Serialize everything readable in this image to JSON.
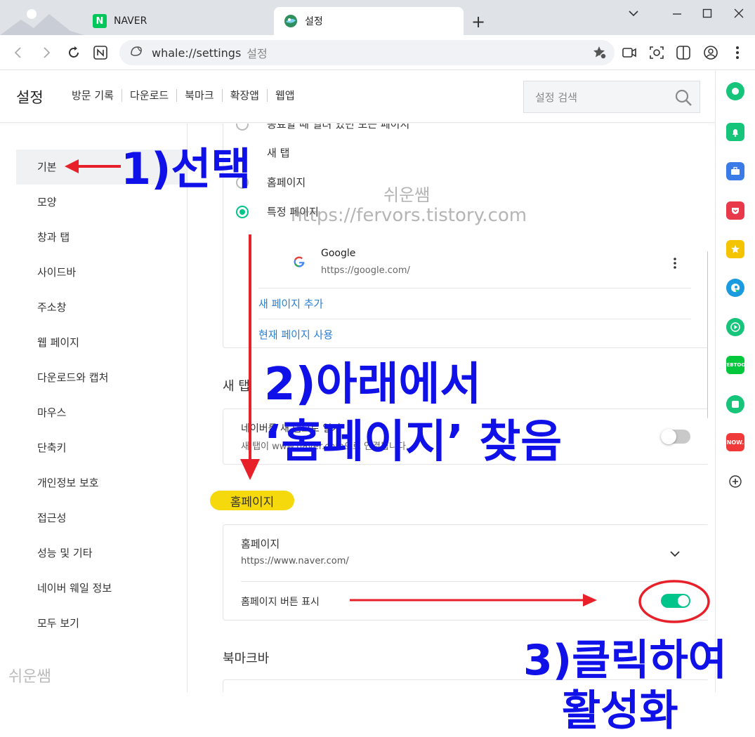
{
  "browser": {
    "tabs": [
      {
        "icon": "naver-n-icon",
        "favicon_text": "N",
        "title": "NAVER",
        "active": false
      },
      {
        "icon": "whale-icon",
        "title": "설정",
        "active": true
      }
    ],
    "new_tab_glyph": "+",
    "address": {
      "url": "whale://settings",
      "hint": "설정"
    }
  },
  "settings": {
    "title": "설정",
    "top_nav": [
      "방문 기록",
      "다운로드",
      "북마크",
      "확장앱",
      "웹앱"
    ],
    "search_placeholder": "설정 검색",
    "sidebar": [
      {
        "label": "기본",
        "active": true
      },
      {
        "label": "모양"
      },
      {
        "label": "창과 탭"
      },
      {
        "label": "사이드바"
      },
      {
        "label": "주소창"
      },
      {
        "label": "웹 페이지"
      },
      {
        "label": "다운로드와 캡처"
      },
      {
        "label": "마우스"
      },
      {
        "label": "단축키"
      },
      {
        "label": "개인정보 보호"
      },
      {
        "label": "접근성"
      },
      {
        "label": "성능 및 기타"
      },
      {
        "label": "네이버 웨일 정보"
      },
      {
        "label": "모두 보기"
      }
    ],
    "sidebar_watermark": "쉬운쌤",
    "startup": {
      "options": [
        "종료할 때 열려 있던 모든 페이지",
        "새 탭",
        "홈페이지",
        "특정 페이지"
      ],
      "selected": "특정 페이지",
      "page": {
        "name": "Google",
        "url": "https://google.com/"
      },
      "add_link": "새 페이지 추가",
      "use_current_link": "현재 페이지 사용"
    },
    "new_tab_section": {
      "title": "새 탭",
      "row_title": "네이버를 새 탭으로 열기",
      "row_desc": "새 탭이 www.naver.com으로 연결됩니다.",
      "toggle_on": false
    },
    "homepage_section": {
      "title": "홈페이지",
      "row_title": "홈페이지",
      "row_value": "https://www.naver.com/",
      "button_label": "홈페이지 버튼 표시",
      "toggle_on": true
    },
    "bookmark_bar_section": {
      "title": "북마크바"
    }
  },
  "right_panel_icons": [
    {
      "name": "whale-space-icon",
      "color": "#16c47a"
    },
    {
      "name": "bell-icon",
      "color": "#16c47a"
    },
    {
      "name": "toolbox-icon",
      "color": "#3b7be8"
    },
    {
      "name": "pocket-icon",
      "color": "#e8394a"
    },
    {
      "name": "star-icon",
      "color": "#f5c400"
    },
    {
      "name": "papago-icon",
      "color": "#1a9be0"
    },
    {
      "name": "play-icon",
      "color": "#16c47a"
    },
    {
      "name": "webtoon-icon",
      "color": "#00c73c",
      "text": "WEBTOON"
    },
    {
      "name": "square-icon",
      "color": "#16c47a"
    },
    {
      "name": "now-icon",
      "color": "#f03a3a",
      "text": "NOW."
    },
    {
      "name": "add-icon",
      "color": "#333333"
    }
  ],
  "annotations": {
    "step1": "1)선택",
    "step2_line1": "2)아래에서",
    "step2_line2": "‘홈페이지’ 찾음",
    "step3_line1": "3)클릭하여",
    "step3_line2": "활성화",
    "watermark_name": "쉬운쌤",
    "watermark_url": "https://fervors.tistory.com"
  },
  "colors": {
    "accent_green": "#00c58a",
    "link_blue": "#2a7fd4",
    "annotation_blue": "#1010e8",
    "annotation_red": "#e8202a",
    "highlight_yellow": "#f5d90c"
  }
}
